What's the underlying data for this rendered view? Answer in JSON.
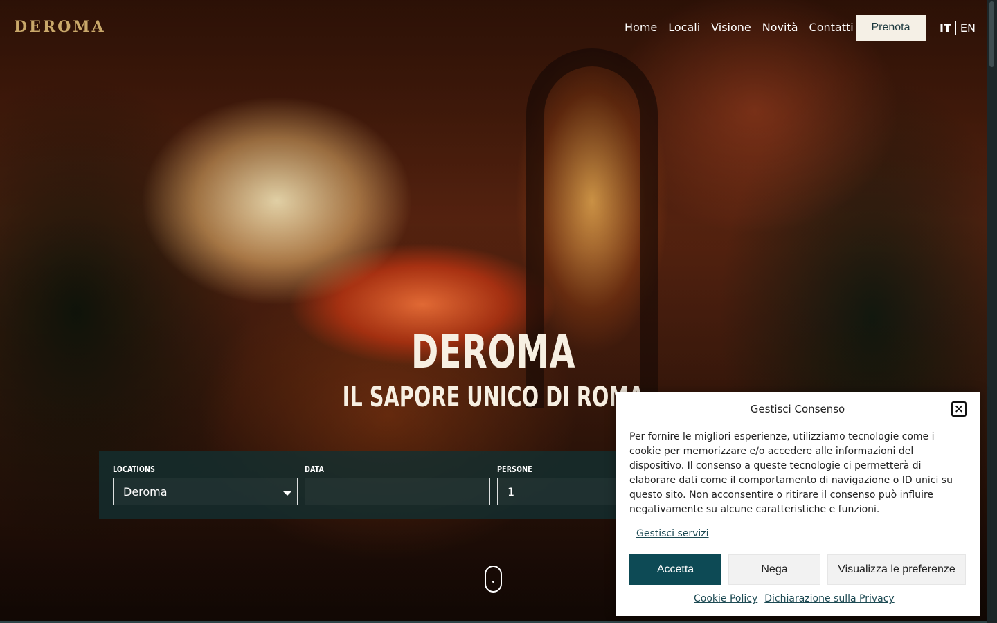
{
  "brand": {
    "logo": "DEROMA"
  },
  "nav": {
    "items": [
      {
        "label": "Home"
      },
      {
        "label": "Locali"
      },
      {
        "label": "Visione"
      },
      {
        "label": "Novità"
      },
      {
        "label": "Contatti"
      }
    ],
    "cta_label": "Prenota"
  },
  "language": {
    "current": "IT",
    "other": "EN"
  },
  "hero": {
    "title": "DEROMA",
    "subtitle": "IL SAPORE UNICO DI ROMA"
  },
  "booking": {
    "locations_label": "LOCATIONS",
    "locations_value": "Deroma",
    "data_label": "DATA",
    "data_value": "",
    "persone_label": "PERSONE",
    "persone_value": "1"
  },
  "consent": {
    "title": "Gestisci Consenso",
    "text": "Per fornire le migliori esperienze, utilizziamo tecnologie come i cookie per memorizzare e/o accedere alle informazioni del dispositivo. Il consenso a queste tecnologie ci permetterà di elaborare dati come il comportamento di navigazione o ID unici su questo sito. Non acconsentire o ritirare il consenso può influire negativamente su alcune caratteristiche e funzioni.",
    "manage_link": "Gestisci servizi",
    "accept_label": "Accetta",
    "deny_label": "Nega",
    "prefs_label": "Visualizza le preferenze",
    "cookie_policy": "Cookie Policy",
    "privacy": "Dichiarazione sulla Privacy",
    "close_symbol": "×"
  },
  "colors": {
    "accent": "#0d4a55",
    "cream": "#f5f0e6",
    "logo_gold": "#c9a86a",
    "booking_bg": "#142e30"
  }
}
